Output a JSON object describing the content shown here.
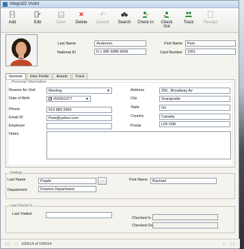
{
  "window": {
    "title": "Integra32 Visitor"
  },
  "toolbar": {
    "add": "Add",
    "edit": "Edit",
    "save": "Save",
    "delete": "Delete",
    "cancel": "Cancel",
    "search": "Search",
    "check_in": "Check In",
    "check_out": "Check Out",
    "track": "Track",
    "receipt": "Receipt"
  },
  "profile": {
    "last_name_label": "Last Name",
    "last_name": "Anderson",
    "national_id_label": "National ID",
    "national_id": "D L 985 6985 6696",
    "first_name_label": "First Name",
    "first_name": "Pam",
    "card_number_label": "Card Number",
    "card_number": "2361"
  },
  "tabs": [
    "General",
    "User Fields",
    "Assets",
    "Track"
  ],
  "general": {
    "group_title": "Personal Information",
    "reason_label": "Reason for Visit",
    "reason": "Meeting",
    "dob_label": "Date of Birth",
    "dob": "20/09/1977",
    "phone_label": "Phone",
    "phone": "519 889 2566",
    "email_label": "Email ID",
    "email": "Pam@yahoo.com",
    "employer_label": "Employer",
    "employer": "",
    "notes_label": "Notes",
    "notes": "",
    "address_label": "Address",
    "address": "256 , Broadway Av",
    "city_label": "City",
    "city": "Orangeville",
    "state_label": "State",
    "state": "On",
    "country_label": "Country",
    "country": "Canada",
    "postal_label": "Postal",
    "postal": "L09 O98"
  },
  "visiting": {
    "group_title": "Visiting",
    "last_name_label": "Last Name",
    "last_name": "Pagde",
    "browse": "...",
    "first_name_label": "First Name",
    "first_name": "Rachael",
    "department_label": "Department",
    "department": "Finance Department"
  },
  "last_check_in": {
    "group_title": "Last Check In",
    "last_visited_label": "Last Visited",
    "last_visited": "",
    "checked_in_label": "Checked In",
    "checked_in": "",
    "checked_out_label": "Checked Out",
    "checked_out": ""
  },
  "status": {
    "record": "100014 of 100014"
  }
}
